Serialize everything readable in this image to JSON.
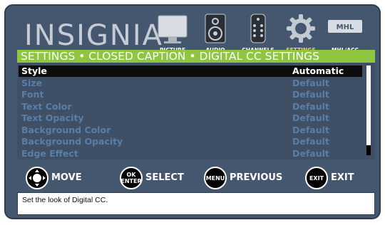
{
  "brand": {
    "logo_text": "INSIGNIA"
  },
  "nav": [
    {
      "label": "PICTURE",
      "icon": "tv-icon",
      "active": false
    },
    {
      "label": "AUDIO",
      "icon": "speaker-icon",
      "active": false
    },
    {
      "label": "CHANNELS",
      "icon": "remote-icon",
      "active": false
    },
    {
      "label": "SETTINGS",
      "icon": "gear-icon",
      "active": true
    },
    {
      "label": "MHL/ACC",
      "icon": "mhl-icon",
      "icon_text": "MHL",
      "active": false
    }
  ],
  "breadcrumb": "SETTINGS • CLOSED CAPTION • DIGITAL CC SETTINGS",
  "settings": [
    {
      "label": "Style",
      "value": "Automatic",
      "selected": true
    },
    {
      "label": "Size",
      "value": "Default",
      "selected": false
    },
    {
      "label": "Font",
      "value": "Default",
      "selected": false
    },
    {
      "label": "Text Color",
      "value": "Default",
      "selected": false
    },
    {
      "label": "Text Opacity",
      "value": "Default",
      "selected": false
    },
    {
      "label": "Background Color",
      "value": "Default",
      "selected": false
    },
    {
      "label": "Background Opacity",
      "value": "Default",
      "selected": false
    },
    {
      "label": "Edge Effect",
      "value": "Default",
      "selected": false
    }
  ],
  "hints": {
    "move": {
      "label": "MOVE",
      "icon": "dpad-icon"
    },
    "select": {
      "label": "SELECT",
      "button_text": "OK ENTER"
    },
    "previous": {
      "label": "PREVIOUS",
      "button_text": "MENU"
    },
    "exit": {
      "label": "EXIT",
      "button_text": "EXIT"
    }
  },
  "status_text": "Set the look of Digital CC.",
  "colors": {
    "accent_green": "#8ec63f",
    "panel": "#45576f",
    "active_nav": "#ffd24a",
    "dim_item": "#5a7fa6"
  }
}
